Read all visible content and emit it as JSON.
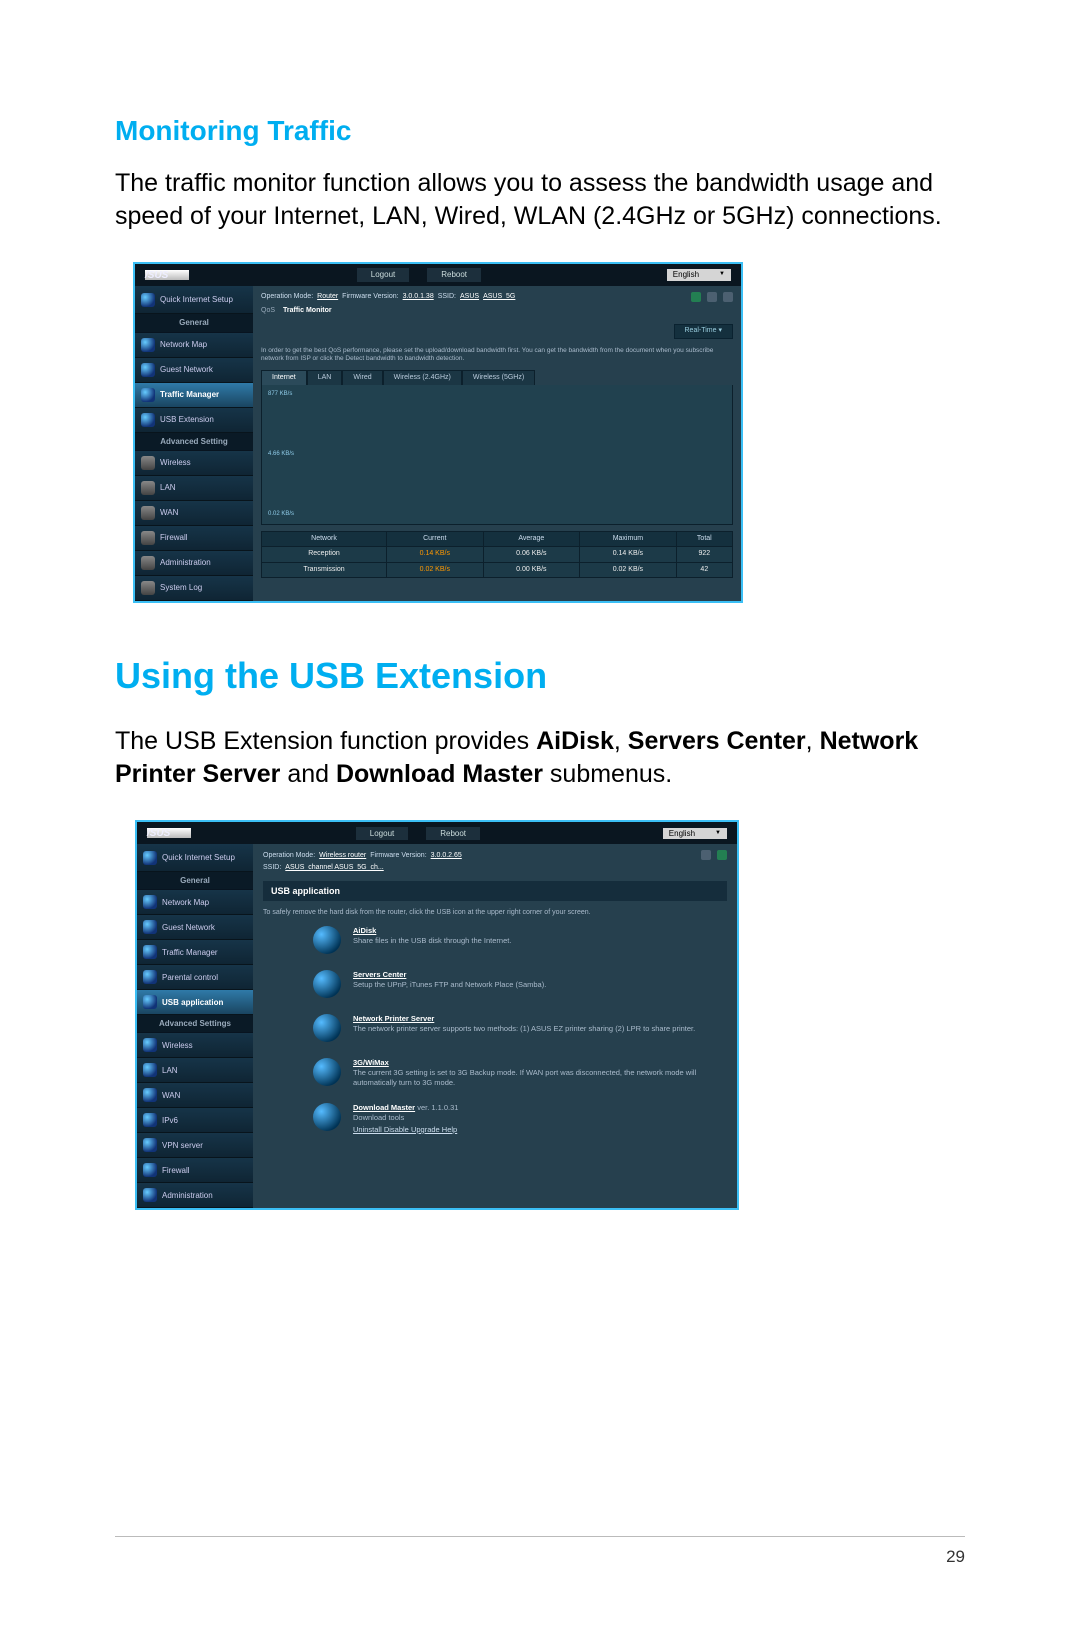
{
  "section1": {
    "title": "Monitoring Traffic",
    "body": "The traffic monitor function allows you to assess the bandwidth usage and speed of your Internet, LAN, Wired, WLAN (2.4GHz or 5GHz) connections."
  },
  "section2": {
    "title": "Using the USB Extension",
    "body_pre": "The USB Extension function provides ",
    "b1": "AiDisk",
    "sep1": ", ",
    "b2": "Servers Center",
    "sep2": ", ",
    "b3": "Network Printer Server",
    "sep3": " and ",
    "b4": "Download Master",
    "body_post": " submenus."
  },
  "router1": {
    "logo": "/SUS",
    "top": {
      "logout": "Logout",
      "reboot": "Reboot",
      "lang": "English"
    },
    "opmode_label": "Operation Mode:",
    "opmode_value": "Router",
    "fw_label": "Firmware Version:",
    "fw_value": "3.0.0.1.38",
    "ssid_label": "SSID:",
    "ssid1": "ASUS",
    "ssid2": "ASUS_5G",
    "qostabs": {
      "qos": "QoS",
      "tm": "Traffic Monitor"
    },
    "realtime": "Real-Time",
    "info": "In order to get the best QoS performance, please set the upload/download bandwidth first. You can get the bandwidth from the document when you subscribe network from ISP or click the Detect bandwidth to bandwidth detection.",
    "graph_tabs": [
      "Internet",
      "LAN",
      "Wired",
      "Wireless (2.4GHz)",
      "Wireless (5GHz)"
    ],
    "graph_labels": [
      "877 KB/s",
      "4.66 KB/s",
      "0.02 KB/s"
    ],
    "stats": {
      "headers": [
        "Network",
        "Current",
        "Average",
        "Maximum",
        "Total"
      ],
      "rows": [
        {
          "name": "Reception",
          "current": "0.14 KB/s",
          "average": "0.06 KB/s",
          "maximum": "0.14 KB/s",
          "total": "922"
        },
        {
          "name": "Transmission",
          "current": "0.02 KB/s",
          "average": "0.00 KB/s",
          "maximum": "0.02 KB/s",
          "total": "42"
        }
      ]
    },
    "sidebar": {
      "qis": "Quick Internet Setup",
      "general": "General",
      "items_general": [
        "Network Map",
        "Guest Network",
        "Traffic Manager",
        "USB Extension"
      ],
      "advanced": "Advanced Setting",
      "items_adv": [
        "Wireless",
        "LAN",
        "WAN",
        "Firewall",
        "Administration",
        "System Log"
      ]
    }
  },
  "router2": {
    "top": {
      "logout": "Logout",
      "reboot": "Reboot",
      "lang": "English"
    },
    "opmode_label": "Operation Mode:",
    "opmode_value": "Wireless router",
    "fw_label": "Firmware Version:",
    "fw_value": "3.0.0.2.65",
    "ssid_label": "SSID:",
    "ssid_value": "ASUS_channel  ASUS_5G_ch...",
    "sidebar": {
      "qis": "Quick Internet Setup",
      "general": "General",
      "items_general": [
        "Network Map",
        "Guest Network",
        "Traffic Manager",
        "Parental control",
        "USB application"
      ],
      "advanced": "Advanced Settings",
      "items_adv": [
        "Wireless",
        "LAN",
        "WAN",
        "IPv6",
        "VPN server",
        "Firewall",
        "Administration"
      ]
    },
    "panel_title": "USB application",
    "panel_note": "To safely remove the hard disk from the router, click the USB icon at the upper right corner of your screen.",
    "apps": [
      {
        "title": "AiDisk",
        "desc": "Share files in the USB disk through the Internet."
      },
      {
        "title": "Servers Center",
        "desc": "Setup the UPnP, iTunes FTP and Network Place (Samba)."
      },
      {
        "title": "Network Printer Server",
        "desc": "The network printer server supports two methods: (1) ASUS EZ printer sharing (2) LPR to share printer."
      },
      {
        "title": "3G/WiMax",
        "desc": "The current 3G setting is set to 3G Backup mode. If WAN port was disconnected, the network mode will automatically turn to 3G mode."
      },
      {
        "title": "Download Master",
        "ver": "ver. 1.1.0.31",
        "desc": "Download tools",
        "links": "Uninstall  Disable  Upgrade  Help"
      }
    ]
  },
  "page_number": "29"
}
